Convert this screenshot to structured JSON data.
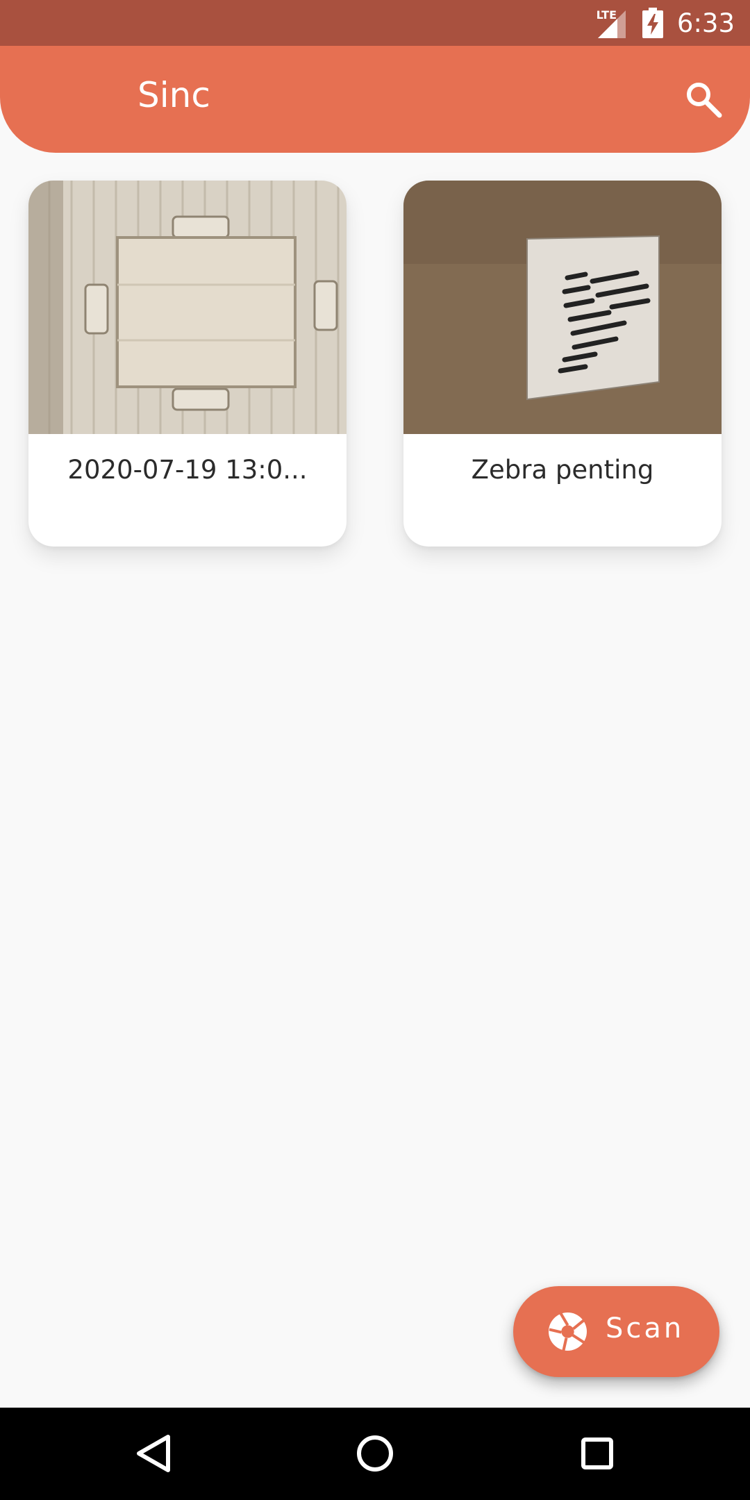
{
  "status_bar": {
    "network": "LTE",
    "time": "6:33",
    "icons": [
      "signal-icon",
      "battery-charging-icon"
    ]
  },
  "app_bar": {
    "title": "Sinc",
    "icons": [
      "search-icon"
    ]
  },
  "cards": [
    {
      "label": "2020-07-19 13:0...",
      "image": "table-and-chairs-photo"
    },
    {
      "label": "Zebra penting",
      "image": "zebra-painting-photo"
    }
  ],
  "fab": {
    "label": "Scan",
    "icon": "camera-shutter-icon"
  },
  "nav_bar": {
    "icons": [
      "back-icon",
      "home-icon",
      "recents-icon"
    ]
  },
  "colors": {
    "status_bar": "#a9513f",
    "accent": "#e67052",
    "background": "#f9f9f9"
  }
}
